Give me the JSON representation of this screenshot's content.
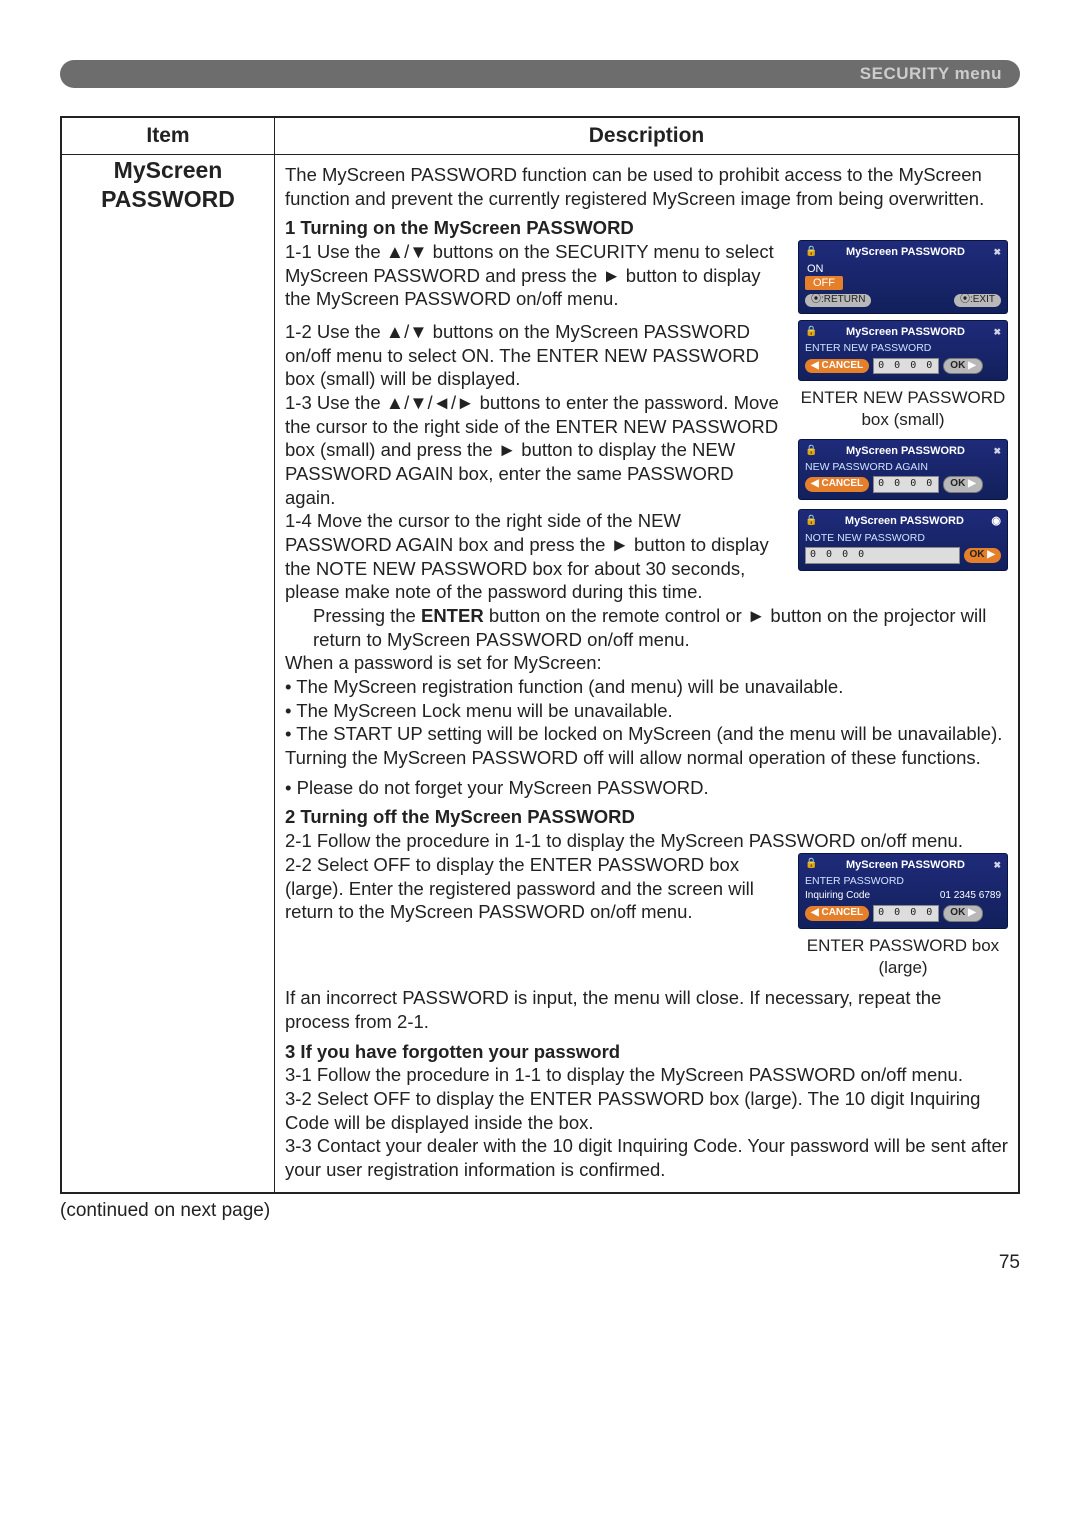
{
  "header": {
    "title": "SECURITY menu"
  },
  "table": {
    "col_item": "Item",
    "col_desc": "Description",
    "item_name": "MyScreen PASSWORD"
  },
  "intro": "The MyScreen PASSWORD function can be used to prohibit access to the MyScreen function and prevent the currently registered MyScreen image from being overwritten.",
  "s1": {
    "title": "1 Turning on the MyScreen PASSWORD",
    "p11": "1-1 Use the ▲/▼ buttons on the SECURITY menu to select MyScreen PASSWORD and press the ► button to display the MyScreen PASSWORD on/off menu.",
    "p12": "1-2 Use the ▲/▼ buttons on the MyScreen PASSWORD on/off menu to select ON. The ENTER NEW PASSWORD box (small) will be displayed.",
    "p13": "1-3 Use the ▲/▼/◄/► buttons to enter the password. Move the cursor to the right side of the ENTER NEW PASSWORD box (small) and press the ► button to display the NEW PASSWORD AGAIN box, enter the same PASSWORD again.",
    "p14": "1-4 Move the cursor to the right side of the NEW PASSWORD AGAIN box and press the ► button to display the NOTE NEW PASSWORD box for about 30 seconds, please make note of the password during this time.",
    "p15a": "Pressing the ",
    "p15b": "ENTER",
    "p15c": " button on the remote control or ► button on the projector will return to MyScreen PASSWORD on/off menu.",
    "when": "When a password is set for MyScreen:",
    "b1": "• The MyScreen registration function (and menu) will be unavailable.",
    "b2": "• The MyScreen Lock menu will be unavailable.",
    "b3": "• The START UP setting will be locked on MyScreen (and the menu will be unavailable).",
    "off": "Turning the MyScreen PASSWORD off will allow normal operation of these functions.",
    "note": "• Please do not forget your MyScreen PASSWORD."
  },
  "s2": {
    "title": "2 Turning off the MyScreen PASSWORD",
    "p21": "2-1 Follow the procedure in 1-1 to display the MyScreen PASSWORD on/off menu.",
    "p22": "2-2 Select OFF to display the ENTER PASSWORD box (large). Enter the registered password and the screen will return to the MyScreen PASSWORD on/off menu.",
    "err": "If an incorrect PASSWORD is input, the menu will close. If necessary, repeat the process from 2-1."
  },
  "s3": {
    "title": "3 If you have forgotten your password",
    "p31": "3-1 Follow the procedure in 1-1 to display the MyScreen PASSWORD on/off menu.",
    "p32": "3-2 Select OFF to display the ENTER PASSWORD box (large). The 10 digit Inquiring Code will be displayed inside the box.",
    "p33": "3-3 Contact your dealer with the 10 digit Inquiring Code. Your password will be sent after your user registration information is confirmed."
  },
  "osd": {
    "title": "MyScreen PASSWORD",
    "on": "ON",
    "off": "OFF",
    "return": "⦿:RETURN",
    "exit": "⦿:EXIT",
    "enter_new": "ENTER NEW PASSWORD",
    "new_again": "NEW PASSWORD AGAIN",
    "note_new": "NOTE NEW PASSWORD",
    "enter_pw": "ENTER PASSWORD",
    "inq": "Inquiring Code",
    "inq_val": "01 2345 6789",
    "cancel": "CANCEL",
    "ok": "OK",
    "digits": "0 0 0 0",
    "cap_small": "ENTER NEW PASSWORD box (small)",
    "cap_large": "ENTER PASSWORD box (large)"
  },
  "continued": "(continued on next page)",
  "page_number": "75"
}
